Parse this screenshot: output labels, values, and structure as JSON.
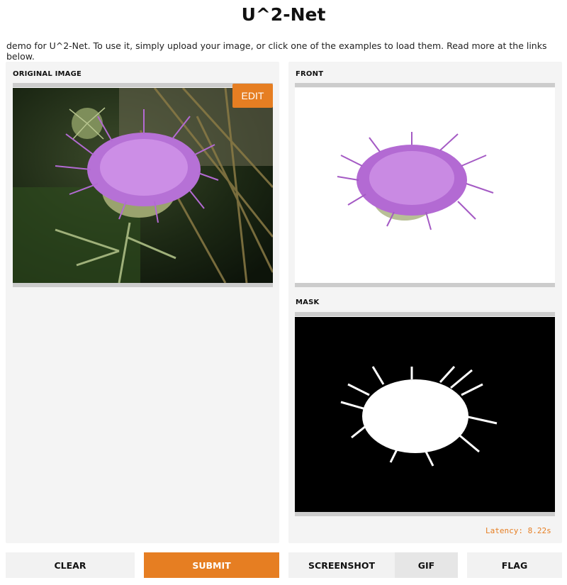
{
  "app": {
    "title": "U^2-Net",
    "description": "demo for U^2-Net. To use it, simply upload your image, or click one of the examples to load them. Read more at the links below."
  },
  "input_panel": {
    "label": "ORIGINAL IMAGE",
    "edit_label": "EDIT",
    "accent_color": "#e67e22"
  },
  "output_panel": {
    "front_label": "FRONT",
    "mask_label": "MASK",
    "latency": "Latency: 8.22s"
  },
  "actions": {
    "clear": "CLEAR",
    "submit": "SUBMIT",
    "screenshot": "SCREENSHOT",
    "gif": "GIF",
    "flag": "FLAG"
  },
  "icons": {
    "original": "thistle-photo",
    "front": "thistle-cutout",
    "mask": "thistle-mask"
  }
}
